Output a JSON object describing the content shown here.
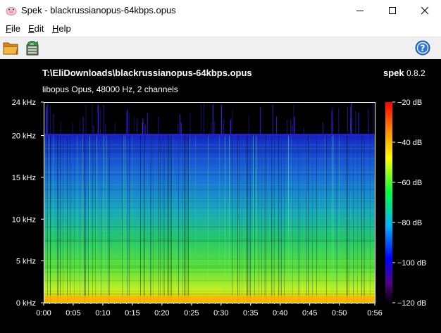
{
  "window": {
    "title": "Spek - blackrussianopus-64kbps.opus",
    "colors": {
      "titlebar_bg": "#ffffff",
      "chrome_bg": "#f0f0f0",
      "plot_bg": "#000000"
    }
  },
  "titlebar": {
    "icon": "spek-app-icon",
    "buttons": {
      "minimize": "minimize-icon",
      "maximize": "maximize-icon",
      "close": "close-icon"
    }
  },
  "menu": {
    "file": {
      "mnemonic": "F",
      "rest": "ile"
    },
    "edit": {
      "mnemonic": "E",
      "rest": "dit"
    },
    "help": {
      "mnemonic": "H",
      "rest": "elp"
    }
  },
  "toolbar": {
    "open_icon": "folder-open-icon",
    "preferences_icon": "preferences-icon",
    "help_icon": "help-circle-icon"
  },
  "spectrogram": {
    "file_path": "T:\\EliDownloads\\blackrussianopus-64kbps.opus",
    "stream_info": "libopus Opus, 48000 Hz, 2 channels",
    "brand_name": "spek",
    "brand_version": "0.8.2",
    "cutoff_khz": 20.2,
    "chart_data": {
      "type": "heatmap",
      "x": {
        "min_seconds": 0,
        "max_seconds": 56,
        "ticks": [
          {
            "value": 0,
            "label": "0:00"
          },
          {
            "value": 5,
            "label": "0:05"
          },
          {
            "value": 10,
            "label": "0:10"
          },
          {
            "value": 15,
            "label": "0:15"
          },
          {
            "value": 20,
            "label": "0:20"
          },
          {
            "value": 25,
            "label": "0:25"
          },
          {
            "value": 30,
            "label": "0:30"
          },
          {
            "value": 35,
            "label": "0:35"
          },
          {
            "value": 40,
            "label": "0:40"
          },
          {
            "value": 45,
            "label": "0:45"
          },
          {
            "value": 50,
            "label": "0:50"
          },
          {
            "value": 56,
            "label": "0:56"
          }
        ]
      },
      "y": {
        "min_khz": 0,
        "max_khz": 24,
        "ticks": [
          {
            "value": 0,
            "label": "0 kHz"
          },
          {
            "value": 5,
            "label": "5 kHz"
          },
          {
            "value": 10,
            "label": "10 kHz"
          },
          {
            "value": 15,
            "label": "15 kHz"
          },
          {
            "value": 20,
            "label": "20 kHz"
          },
          {
            "value": 24,
            "label": "24 kHz"
          }
        ]
      },
      "colorbar": {
        "min_db": -120,
        "max_db": -20,
        "ticks": [
          {
            "value": -20,
            "label": "−20 dB"
          },
          {
            "value": -40,
            "label": "−40 dB"
          },
          {
            "value": -60,
            "label": "−60 dB"
          },
          {
            "value": -80,
            "label": "−80 dB"
          },
          {
            "value": -100,
            "label": "−100 dB"
          },
          {
            "value": -120,
            "label": "−120 dB"
          }
        ],
        "stops": [
          "#ff0000",
          "#ff8a00",
          "#ffff00",
          "#00ff40",
          "#00b0ff",
          "#0000ff",
          "#550088",
          "#000000"
        ]
      }
    }
  }
}
